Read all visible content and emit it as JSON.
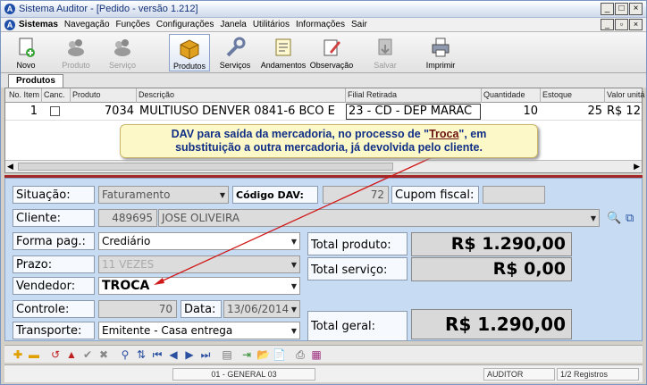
{
  "window": {
    "title": "Sistema Auditor - [Pedido - versão 1.212]",
    "controls": [
      "_",
      "□",
      "×"
    ]
  },
  "menu": {
    "items": [
      "Sistemas",
      "Navegação",
      "Funções",
      "Configurações",
      "Janela",
      "Utilitários",
      "Informações",
      "Sair"
    ],
    "controls": [
      "_",
      "▫",
      "×"
    ]
  },
  "toolbar": {
    "buttons": [
      {
        "label": "Novo",
        "icon": "new-document-icon",
        "enabled": true
      },
      {
        "label": "Produto",
        "icon": "product-icon",
        "enabled": false
      },
      {
        "label": "Serviço",
        "icon": "service-icon",
        "enabled": false
      },
      {
        "label": "Produtos",
        "icon": "box-icon",
        "enabled": true,
        "active": true
      },
      {
        "label": "Serviços",
        "icon": "wrench-icon",
        "enabled": true
      },
      {
        "label": "Andamentos",
        "icon": "progress-icon",
        "enabled": true
      },
      {
        "label": "Observação",
        "icon": "note-pencil-icon",
        "enabled": true
      },
      {
        "label": "Salvar",
        "icon": "save-icon",
        "enabled": false
      },
      {
        "label": "Imprimir",
        "icon": "printer-icon",
        "enabled": true
      }
    ]
  },
  "tab": {
    "label": "Produtos"
  },
  "grid": {
    "headers": [
      "No. Item",
      "Canc.",
      "Produto",
      "Descrição",
      "Filial Retirada",
      "Quantidade",
      "Estoque",
      "Valor unitá"
    ],
    "row": {
      "item": "1",
      "produto": "7034",
      "descricao": "MULTIUSO DENVER 0841-6 BCO E",
      "filial": "23 - CD - DEP MARAC",
      "quantidade": "10",
      "estoque": "25",
      "valor": "R$ 12"
    }
  },
  "callout": {
    "line1_a": "DAV para saída da mercadoria, no processo de \"",
    "line1_u": "Troca",
    "line1_b": "\", em",
    "line2": "substituição a outra mercadoria, já devolvida pelo cliente."
  },
  "form": {
    "situacao_label": "Situação:",
    "situacao_value": "Faturamento",
    "codigo_dav_label": "Código DAV:",
    "codigo_dav_value": "72",
    "cupom_label": "Cupom fiscal:",
    "cupom_value": "",
    "cliente_label": "Cliente:",
    "cliente_code": "489695",
    "cliente_name": "JOSE OLIVEIRA",
    "forma_pag_label": "Forma pag.:",
    "forma_pag_value": "Crediário",
    "prazo_label": "Prazo:",
    "prazo_value": "11 VEZES",
    "vendedor_label": "Vendedor:",
    "vendedor_value": "TROCA",
    "controle_label": "Controle:",
    "controle_value": "70",
    "data_label": "Data:",
    "data_value": "13/06/2014",
    "transporte_label": "Transporte:",
    "transporte_value": "Emitente - Casa entrega",
    "total_produto_label": "Total produto:",
    "total_produto_value": "R$ 1.290,00",
    "total_servico_label": "Total serviço:",
    "total_servico_value": "R$ 0,00",
    "total_geral_label": "Total geral:",
    "total_geral_value": "R$ 1.290,00"
  },
  "status": {
    "filial": "01 - GENERAL 03",
    "user": "AUDITOR",
    "registros": "1/2 Registros"
  }
}
